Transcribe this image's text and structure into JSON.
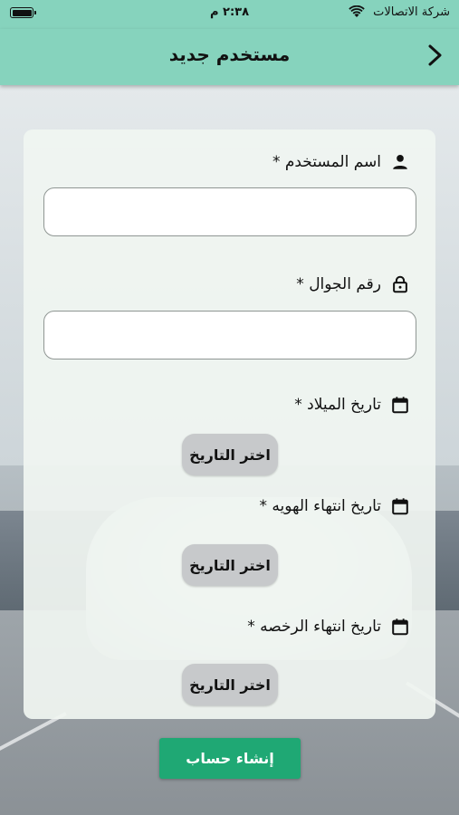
{
  "status_bar": {
    "carrier": "شركة الاتصالات",
    "time": "٢:٣٨ م"
  },
  "nav": {
    "title": "مستخدم جديد",
    "back_icon": "chevron-right-icon"
  },
  "form": {
    "username": {
      "label": "اسم المستخدم *",
      "icon": "person-icon",
      "value": "",
      "placeholder": ""
    },
    "mobile": {
      "label": "رقم الجوال *",
      "icon": "lock-icon",
      "value": "",
      "placeholder": ""
    },
    "birth_date": {
      "label": "تاريخ الميلاد *",
      "icon": "calendar-icon",
      "button": "اختر التاريخ"
    },
    "id_expiry": {
      "label": "تاريخ انتهاء الهويه *",
      "icon": "calendar-icon",
      "button": "اختر التاريخ"
    },
    "license_expiry": {
      "label": "تاريخ انتهاء الرخصه *",
      "icon": "calendar-icon",
      "button": "اختر التاريخ"
    }
  },
  "submit_label": "إنشاء حساب",
  "colors": {
    "header": "#86d3bd",
    "primary_button": "#1fa874",
    "date_button": "#c7c9cb"
  }
}
